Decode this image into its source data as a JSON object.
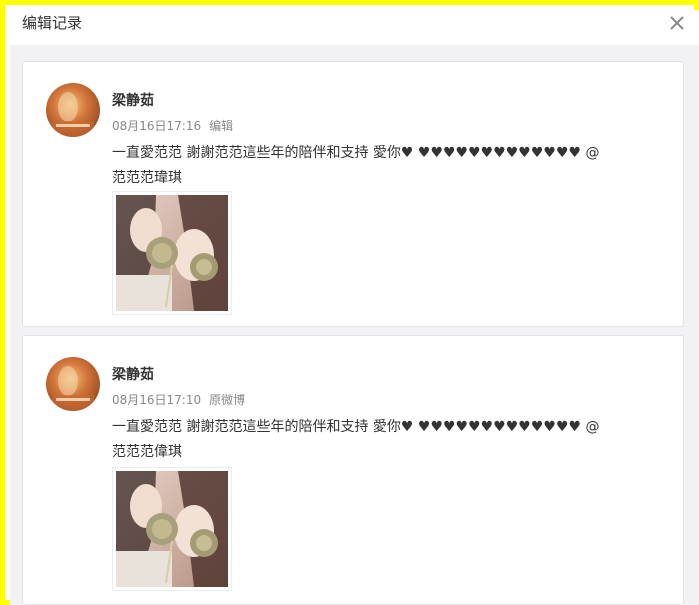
{
  "dialog": {
    "title": "编辑记录",
    "close_icon": "close-icon"
  },
  "records": [
    {
      "author": "梁静茹",
      "timestamp": "08月16日17:16",
      "tag": "编辑",
      "text_main": "一直愛范范 謝謝范范這些年的陪伴和支持 愛你♥ ♥♥♥♥♥♥♥♥♥♥♥♥♥ @",
      "text_mention": "范范范瑋琪",
      "avatar_icon": "user-avatar",
      "photo_icon": "selfie-photo"
    },
    {
      "author": "梁静茹",
      "timestamp": "08月16日17:10",
      "tag": "原微博",
      "text_main": "一直愛范范 謝謝范范這些年的陪伴和支持 愛你♥ ♥♥♥♥♥♥♥♥♥♥♥♥♥ @",
      "text_mention": "范范范偉琪",
      "avatar_icon": "user-avatar",
      "photo_icon": "selfie-photo"
    }
  ],
  "colors": {
    "frame_highlight": "#ffff00",
    "background": "#f2f2f5",
    "text": "#333333",
    "meta": "#888888"
  }
}
